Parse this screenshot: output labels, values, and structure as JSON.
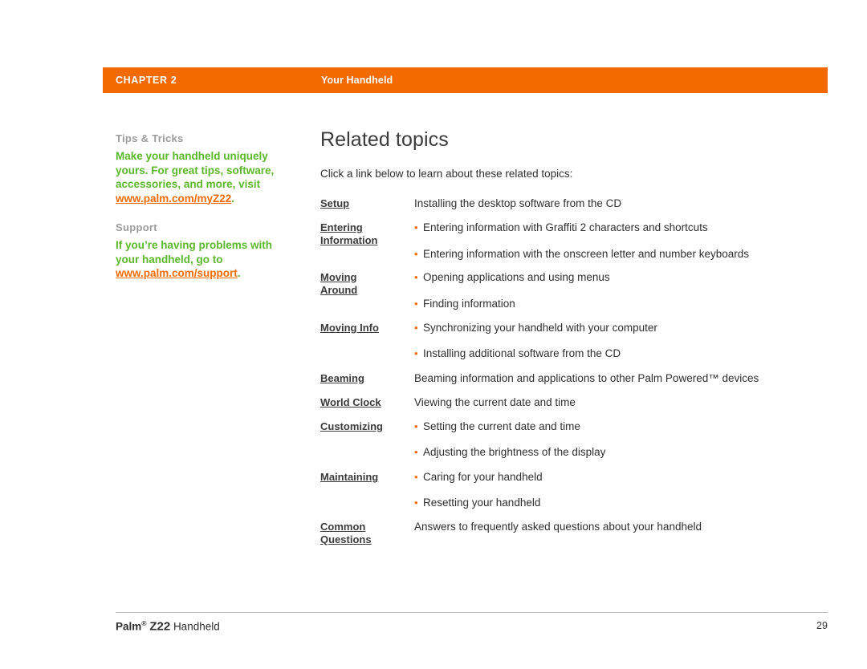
{
  "header": {
    "chapter": "CHAPTER 2",
    "section": "Your Handheld",
    "bar_color": "#f26a00"
  },
  "sidebar": {
    "blocks": [
      {
        "heading": "Tips & Tricks",
        "body": "Make your handheld uniquely yours. For great tips, software, accessories, and more, visit ",
        "link": "www.palm.com/myZ22",
        "trailing": "."
      },
      {
        "heading": "Support",
        "body": "If you’re having problems with your handheld, go to ",
        "link": "www.palm.com/support",
        "trailing": "."
      }
    ]
  },
  "main": {
    "title": "Related topics",
    "intro": "Click a link below to learn about these related topics:",
    "topics": [
      {
        "link": "Setup",
        "link_lines": [
          "Setup"
        ],
        "descriptions": [
          {
            "text": "Installing the desktop software from the CD",
            "bullet": false
          }
        ]
      },
      {
        "link": "Entering Information",
        "link_lines": [
          "Entering ",
          "Information"
        ],
        "descriptions": [
          {
            "text": "Entering information with Graffiti 2 characters and shortcuts",
            "bullet": true
          },
          {
            "text": "Entering information with the onscreen letter and number keyboards",
            "bullet": true
          }
        ]
      },
      {
        "link": "Moving Around",
        "link_lines": [
          "Moving ",
          "Around"
        ],
        "descriptions": [
          {
            "text": "Opening applications and using menus",
            "bullet": true
          },
          {
            "text": "Finding information",
            "bullet": true
          }
        ]
      },
      {
        "link": "Moving Info",
        "link_lines": [
          "Moving Info"
        ],
        "descriptions": [
          {
            "text": "Synchronizing your handheld with your computer",
            "bullet": true
          },
          {
            "text": "Installing additional software from the CD",
            "bullet": true
          }
        ]
      },
      {
        "link": "Beaming",
        "link_lines": [
          "Beaming"
        ],
        "descriptions": [
          {
            "text": "Beaming information and applications to other Palm Powered™ devices",
            "bullet": false
          }
        ]
      },
      {
        "link": "World Clock",
        "link_lines": [
          "World Clock"
        ],
        "descriptions": [
          {
            "text": "Viewing the current date and time",
            "bullet": false
          }
        ]
      },
      {
        "link": "Customizing",
        "link_lines": [
          "Customizing"
        ],
        "descriptions": [
          {
            "text": "Setting the current date and time",
            "bullet": true
          },
          {
            "text": "Adjusting the brightness of the display",
            "bullet": true
          }
        ]
      },
      {
        "link": "Maintaining",
        "link_lines": [
          "Maintaining"
        ],
        "descriptions": [
          {
            "text": "Caring for your handheld",
            "bullet": true
          },
          {
            "text": "Resetting your handheld",
            "bullet": true
          }
        ]
      },
      {
        "link": "Common Questions",
        "link_lines": [
          "Common ",
          "Questions"
        ],
        "descriptions": [
          {
            "text": "Answers to frequently asked questions about your handheld",
            "bullet": false
          }
        ]
      }
    ]
  },
  "footer": {
    "brand": "Palm",
    "registered": "®",
    "model": "Z22",
    "product": "Handheld",
    "page_number": "29"
  }
}
